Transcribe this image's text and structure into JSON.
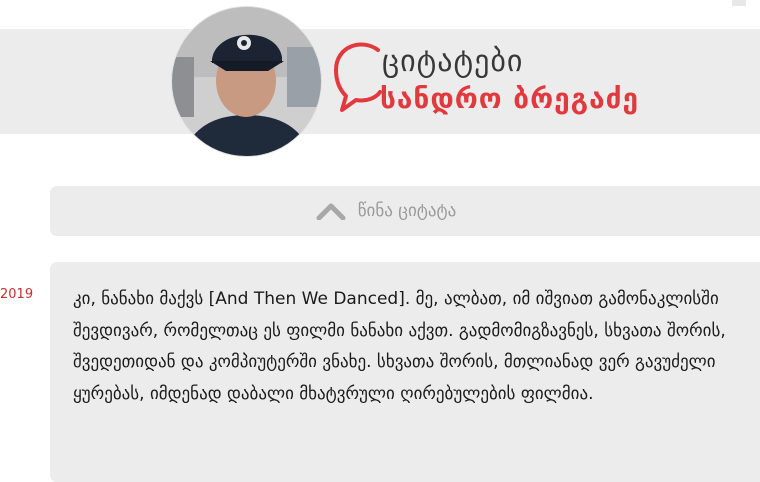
{
  "brand": {
    "title": "ციტატები",
    "author": "სანდრო ბრეგაძე"
  },
  "nav": {
    "prev_label": "წინა ციტატა"
  },
  "quote": {
    "date_fragment": "2019",
    "text_before": "კი, ნანახი მაქვს ",
    "film_title": "[And Then We Danced]",
    "text_after": ". მე, ალბათ, იმ იშვიათ გამონაკლისში შევდივარ, რომელთაც ეს ფილმი ნანახი აქვთ. გადმომიგზავნეს, სხვათა შორის, შვედეთიდან და კომპიუტერში ვნახე. სხვათა შორის, მთლიანად ვერ გავუძელი ყურებას, იმდენად დაბალი მხატვრული ღირებულების ფილმია."
  },
  "colors": {
    "accent": "#e03a3e",
    "panel": "#ececec",
    "date": "#c7302f",
    "muted": "#9a9a9a"
  },
  "icons": {
    "prev": "chevron-up-icon",
    "brand": "speech-bubble-icon"
  }
}
